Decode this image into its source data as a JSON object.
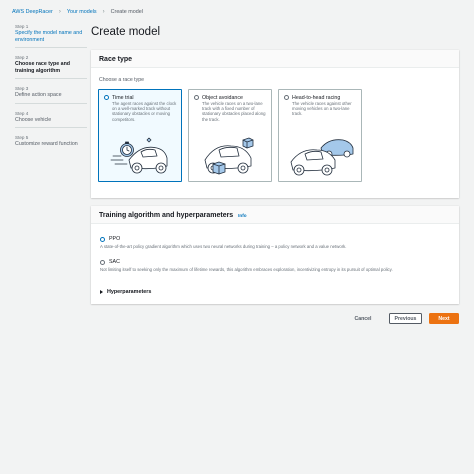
{
  "breadcrumb": {
    "items": [
      "AWS DeepRacer",
      "Your models"
    ],
    "current": "Create model"
  },
  "steps": [
    {
      "label": "Step 1",
      "title": "Specify the model name and environment",
      "state": "link"
    },
    {
      "label": "Step 2",
      "title": "Choose race type and training algorithm",
      "state": "active"
    },
    {
      "label": "Step 3",
      "title": "Define action space",
      "state": "pending"
    },
    {
      "label": "Step 4",
      "title": "Choose vehicle",
      "state": "pending"
    },
    {
      "label": "Step 5",
      "title": "Customize reward function",
      "state": "pending"
    }
  ],
  "page_title": "Create model",
  "race": {
    "heading": "Race type",
    "prompt": "Choose a race type",
    "options": [
      {
        "title": "Time trial",
        "desc": "The agent races against the clock on a well-marked track without stationary obstacles or moving competitors.",
        "selected": true,
        "icon": "time-trial-car-icon"
      },
      {
        "title": "Object avoidance",
        "desc": "The vehicle races on a two-lane track with a fixed number of stationary obstacles placed along the track.",
        "selected": false,
        "icon": "object-avoidance-car-icon"
      },
      {
        "title": "Head-to-head racing",
        "desc": "The vehicle races against other moving vehicles on a two-lane track.",
        "selected": false,
        "icon": "head-to-head-cars-icon"
      }
    ]
  },
  "algorithm": {
    "heading": "Training algorithm and hyperparameters",
    "info": "Info",
    "options": [
      {
        "name": "PPO",
        "desc": "A state-of-the-art policy gradient algorithm which uses two neural networks during training – a policy network and a value network.",
        "selected": true
      },
      {
        "name": "SAC",
        "desc": "Not limiting itself to seeking only the maximum of lifetime rewards, this algorithm embraces exploration, incentivizing entropy in its pursuit of optimal policy.",
        "selected": false
      }
    ],
    "hyperparameters_label": "Hyperparameters"
  },
  "actions": {
    "cancel": "Cancel",
    "previous": "Previous",
    "next": "Next"
  },
  "colors": {
    "link": "#0073bb",
    "primary_button": "#ec7211",
    "background": "#f2f3f3"
  }
}
